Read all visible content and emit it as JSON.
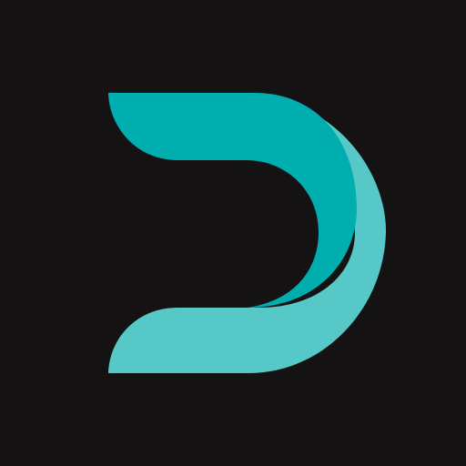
{
  "logo": {
    "name": "d-logo-icon",
    "colors": {
      "background": "#141213",
      "primary": "#00AEAF",
      "secondary": "#56C8C7"
    }
  }
}
